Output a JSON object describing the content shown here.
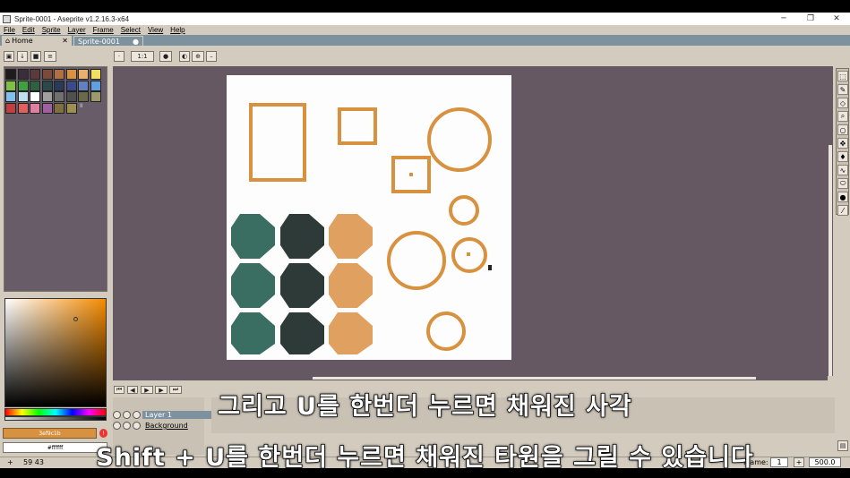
{
  "window": {
    "title": "Sprite-0001 - Aseprite v1.2.16.3-x64",
    "min": "─",
    "restore": "❐",
    "close": "✕"
  },
  "menu": [
    "File",
    "Edit",
    "Sprite",
    "Layer",
    "Frame",
    "Select",
    "View",
    "Help"
  ],
  "tabs": [
    {
      "label": "Home",
      "icon": "home-icon",
      "close": "✕"
    },
    {
      "label": "Sprite-0001",
      "close": "●"
    }
  ],
  "toolbar": {
    "zoom_value": "1:1",
    "icons": [
      "lock-icon",
      "download-icon",
      "stop-icon",
      "list-icon",
      "menu-icon",
      "user-icon",
      "onion-skin-icon",
      "grid-icon",
      "dash-icon"
    ]
  },
  "palette": {
    "colors": [
      "#1c1c1c",
      "#3a2e3a",
      "#5a3a3a",
      "#7a4a3a",
      "#b07040",
      "#d8913e",
      "#e8b070",
      "#f0e060",
      "#80c040",
      "#40a040",
      "#306040",
      "#2a4a4a",
      "#2a3a5a",
      "#3a4a8a",
      "#6080c0",
      "#60a0e0",
      "#80c0f0",
      "#c0e0f0",
      "#ffffff",
      "#a0a0a0",
      "#707070",
      "#505050",
      "#6a6a4a",
      "#9a9a6a",
      "#c04040",
      "#e06060",
      "#e080a0",
      "#a060a0",
      "#807040",
      "#a09050"
    ],
    "extra_label": "II"
  },
  "colors": {
    "fg_label": "3ef9c1b",
    "fg_hex": "#d8913e",
    "bg_label": "#ffffff",
    "warning": "!"
  },
  "timeline": {
    "buttons": [
      "first-frame-icon",
      "prev-frame-icon",
      "play-icon",
      "next-frame-icon",
      "last-frame-icon"
    ],
    "layers": [
      {
        "name": "Layer 1",
        "selected": true
      },
      {
        "name": "Background",
        "selected": false
      }
    ]
  },
  "status": {
    "coords": "59 43",
    "frame_label": "Frame:",
    "frame_value": "1",
    "zoom": "500.0"
  },
  "subtitles": [
    "그리고 U를 한번더 누르면 채워진 사각",
    "Shift + U를 한번더 누르면 채워진 타원을 그릴 수 있습니다"
  ],
  "sprite_colors": {
    "orange": "#d8913e",
    "light_orange": "#e0a060",
    "teal": "#3a6e62",
    "dark": "#2e3a38",
    "canvas_bg": "#665863"
  }
}
